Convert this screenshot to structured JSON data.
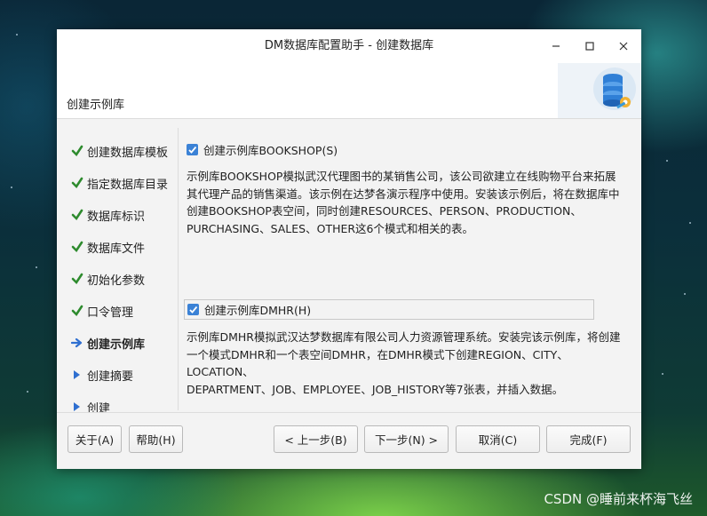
{
  "window": {
    "title": "DM数据库配置助手 - 创建数据库",
    "controls": {
      "minimize": "–",
      "maximize": "☐",
      "close": "✕"
    }
  },
  "header": {
    "title": "创建示例库",
    "logo_icon": "database-gear-icon"
  },
  "sidebar": {
    "items": [
      {
        "label": "创建数据库模板",
        "state": "done"
      },
      {
        "label": "指定数据库目录",
        "state": "done"
      },
      {
        "label": "数据库标识",
        "state": "done"
      },
      {
        "label": "数据库文件",
        "state": "done"
      },
      {
        "label": "初始化参数",
        "state": "done"
      },
      {
        "label": "口令管理",
        "state": "done"
      },
      {
        "label": "创建示例库",
        "state": "current"
      },
      {
        "label": "创建摘要",
        "state": "pending"
      },
      {
        "label": "创建",
        "state": "pending"
      }
    ]
  },
  "content": {
    "bookshop": {
      "label": "创建示例库BOOKSHOP(S)",
      "checked": true,
      "description": [
        "示例库BOOKSHOP模拟武汉代理图书的某销售公司，该公司欲建立在线购物平台来拓展",
        "其代理产品的销售渠道。该示例在达梦各演示程序中使用。安装该示例后，将在数据库中",
        "创建BOOKSHOP表空间，同时创建RESOURCES、PERSON、PRODUCTION、",
        "PURCHASING、SALES、OTHER这6个模式和相关的表。"
      ]
    },
    "dmhr": {
      "label": "创建示例库DMHR(H)",
      "checked": true,
      "description": [
        "示例库DMHR模拟武汉达梦数据库有限公司人力资源管理系统。安装完该示例库，将创建",
        "一个模式DMHR和一个表空间DMHR，在DMHR模式下创建REGION、CITY、LOCATION、",
        "DEPARTMENT、JOB、EMPLOYEE、JOB_HISTORY等7张表，并插入数据。"
      ]
    }
  },
  "footer": {
    "about": "关于(A)",
    "help": "帮助(H)",
    "prev": "< 上一步(B)",
    "next": "下一步(N) >",
    "cancel": "取消(C)",
    "finish": "完成(F)"
  },
  "watermark": "CSDN @睡前来杯海飞丝",
  "colors": {
    "check_green": "#2e8b2e",
    "arrow_blue": "#2f6fd0",
    "checkbox_blue": "#3b82d6"
  }
}
